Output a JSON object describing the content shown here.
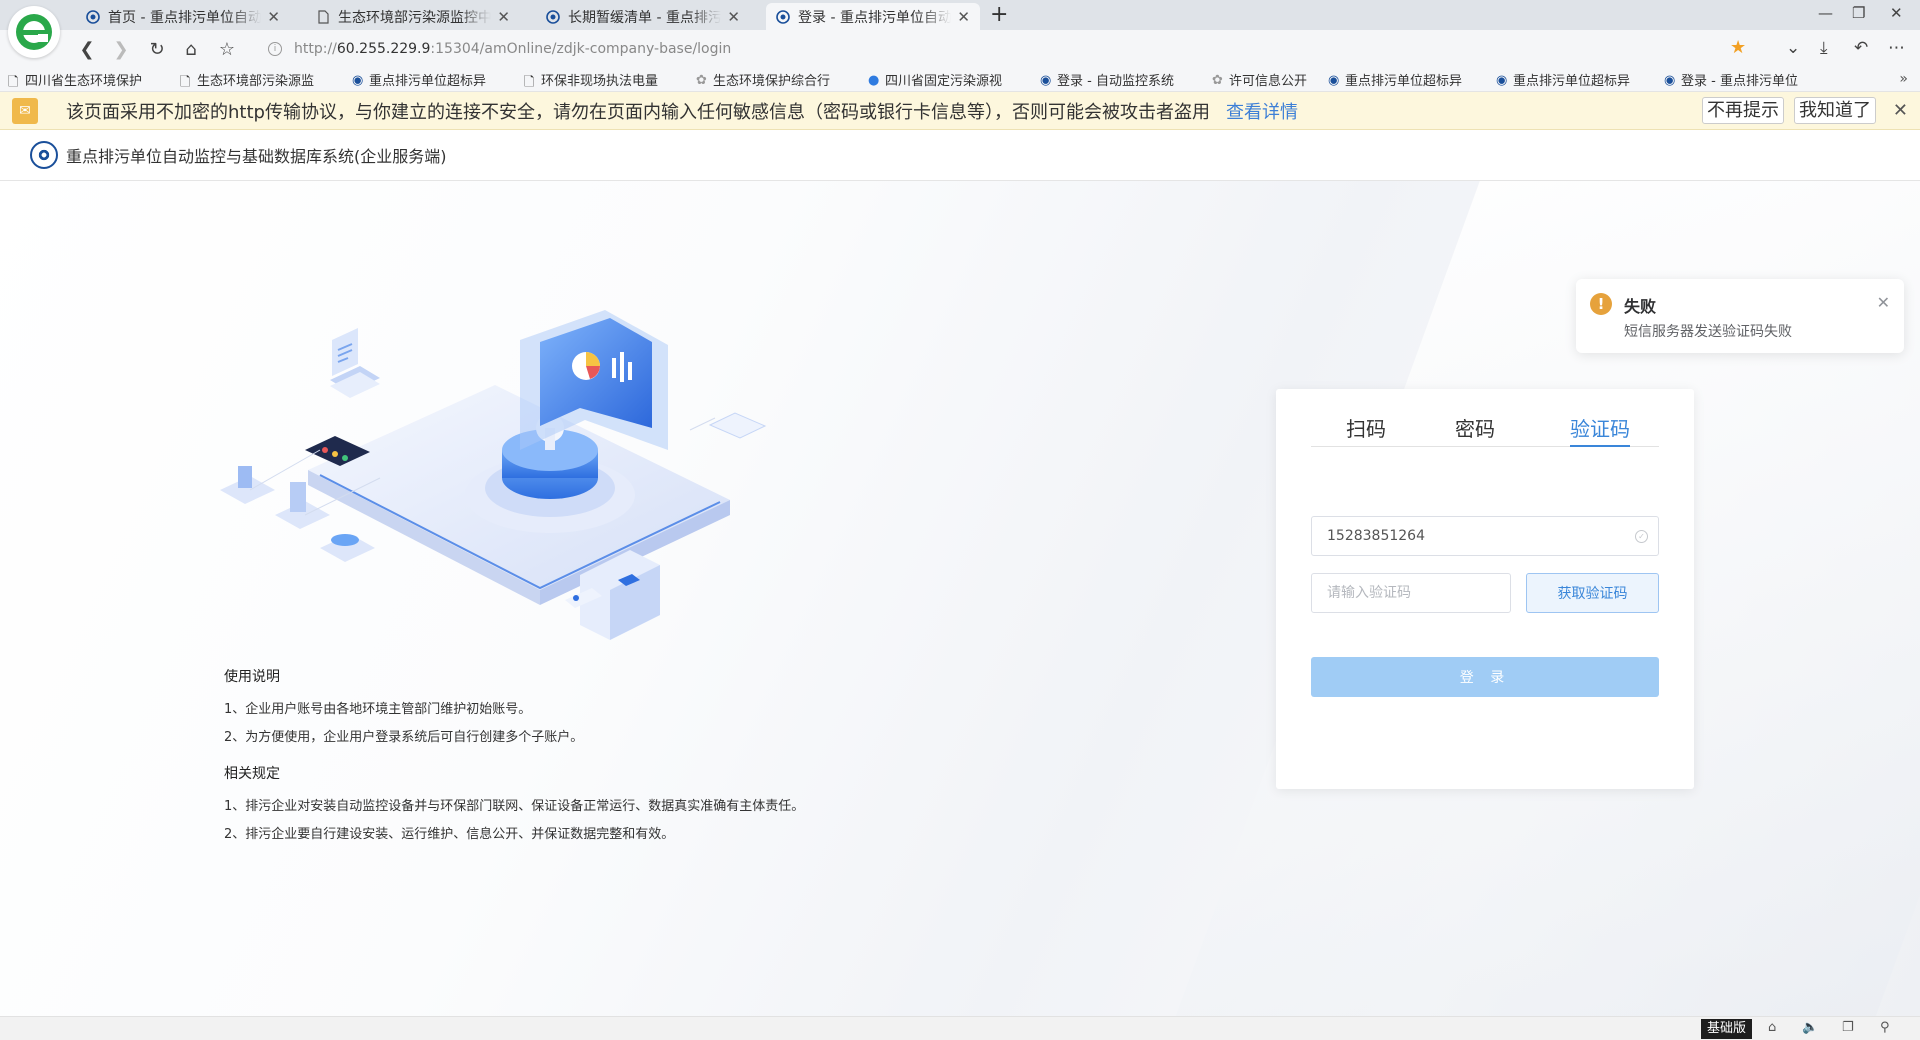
{
  "browser": {
    "tabs": [
      {
        "title": "首页 - 重点排污单位自动监控与基础数据库系统"
      },
      {
        "title": "生态环境部污染源监控中心"
      },
      {
        "title": "长期暂缓清单 - 重点排污单位"
      },
      {
        "title": "登录 - 重点排污单位自动监控"
      }
    ],
    "new_tab_label": "+",
    "url_scheme": "http://",
    "url_host": "60.255.229.9",
    "url_rest": ":15304/amOnline/zdjk-company-base/login",
    "bookmarks": [
      "四川省生态环境保护",
      "生态环境部污染源监",
      "重点排污单位超标异",
      "环保非现场执法电量",
      "生态环境保护综合行",
      "四川省固定污染源视",
      "登录 - 自动监控系统",
      "许可信息公开",
      "重点排污单位超标异",
      "重点排污单位超标异",
      "登录 - 重点排污单位"
    ],
    "bookmarks_more": "»"
  },
  "warning": {
    "text": "该页面采用不加密的http传输协议，与你建立的连接不安全，请勿在页面内输入任何敏感信息（密码或银行卡信息等），否则可能会被攻击者盗用",
    "link": "查看详情",
    "dismiss_forever": "不再提示",
    "acknowledge": "我知道了"
  },
  "header": {
    "title": "重点排污单位自动监控与基础数据库系统(企业服务端)"
  },
  "info": {
    "usage_title": "使用说明",
    "usage_items": [
      "1、企业用户账号由各地环境主管部门维护初始账号。",
      "2、为方便使用，企业用户登录系统后可自行创建多个子账户。"
    ],
    "rules_title": "相关规定",
    "rules_items": [
      "1、排污企业对安装自动监控设备并与环保部门联网、保证设备正常运行、数据真实准确有主体责任。",
      "2、排污企业要自行建设安装、运行维护、信息公开、并保证数据完整和有效。"
    ]
  },
  "login": {
    "tabs": [
      "扫码",
      "密码",
      "验证码"
    ],
    "active_tab": "验证码",
    "phone_value": "15283851264",
    "code_placeholder": "请输入验证码",
    "get_code_label": "获取验证码",
    "submit_label": "登 录"
  },
  "notification": {
    "title": "失败",
    "message": "短信服务器发送验证码失败"
  },
  "statusbar": {
    "mode_label": "基础版"
  }
}
